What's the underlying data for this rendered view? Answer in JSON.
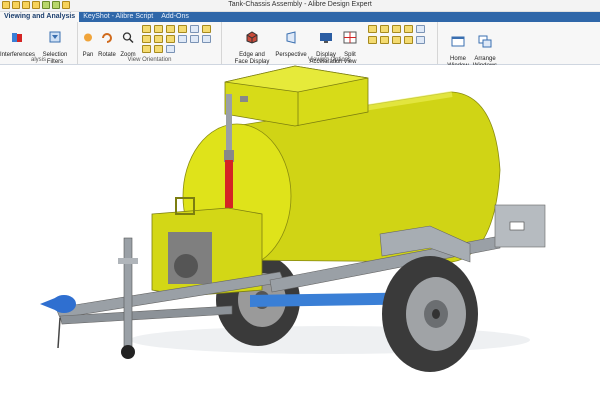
{
  "window": {
    "title": "Tank-Chassis Assembly - Alibre Design Expert"
  },
  "ribbon_tabs": [
    {
      "label": "Viewing and Analysis",
      "active": true
    },
    {
      "label": "KeyShot - Alibre Script",
      "active": false
    },
    {
      "label": "Add-Ons",
      "active": false
    }
  ],
  "ribbon": {
    "analysis": {
      "group_label": "alysis",
      "interferences": "Interferences",
      "selection_filters": "Selection\nFilters"
    },
    "view_orientation": {
      "group_label": "View Orientation",
      "pan": "Pan",
      "rotate": "Rotate",
      "zoom": "Zoom"
    },
    "viewing_options": {
      "group_label": "Viewing Options",
      "edge_face_display": "Edge and\nFace Display",
      "perspective": "Perspective",
      "display_acceleration": "Display\nAcceleration",
      "split_view": "Split\nView"
    },
    "window": {
      "home_window": "Home\nWindow",
      "arrange_windows": "Arrange\nWindows"
    }
  },
  "colors": {
    "tank": "#dcdf18",
    "frame": "#9aa0a6",
    "pipe": "#d42424",
    "axle": "#3a7fd6",
    "tire": "#3a3a3a"
  },
  "icons": [
    "save-icon",
    "undo-icon",
    "redo-icon",
    "interferences-icon",
    "selection-filter-icon",
    "pan-icon",
    "rotate-icon",
    "zoom-icon",
    "view-cube-icon",
    "edge-face-icon",
    "perspective-icon",
    "display-accel-icon",
    "split-view-icon",
    "home-window-icon",
    "arrange-windows-icon"
  ]
}
